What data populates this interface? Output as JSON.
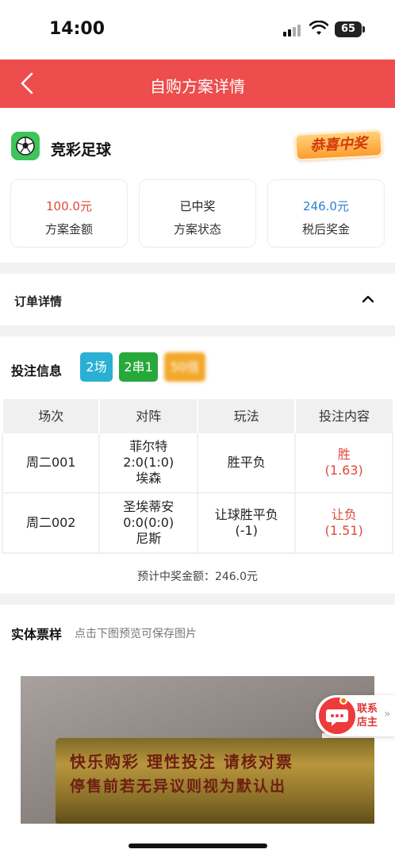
{
  "status_bar": {
    "time": "14:00",
    "battery": "65"
  },
  "nav": {
    "title": "自购方案详情"
  },
  "lottery": {
    "name": "竞彩足球",
    "badge": "恭喜中奖"
  },
  "stats": [
    {
      "value": "100.0元",
      "label": "方案金额",
      "color": "#e0493b"
    },
    {
      "value": "已中奖",
      "label": "方案状态",
      "color": "#222222"
    },
    {
      "value": "246.0元",
      "label": "税后奖金",
      "color": "#2f7fd3"
    }
  ],
  "order": {
    "title": "订单详情"
  },
  "bet": {
    "title": "投注信息",
    "tags": [
      {
        "text": "2场",
        "color": "#2bb0d4"
      },
      {
        "text": "2串1",
        "color": "#27a83a"
      },
      {
        "text": "50倍",
        "color": "#f2a82b"
      }
    ],
    "columns": [
      "场次",
      "对阵",
      "玩法",
      "投注内容"
    ],
    "rows": [
      {
        "match_no": "周二001",
        "home": "菲尔特",
        "score": "2:0(1:0)",
        "away": "埃森",
        "play": "胜平负",
        "play2": "",
        "pick": "胜",
        "odds": "(1.63)"
      },
      {
        "match_no": "周二002",
        "home": "圣埃蒂安",
        "score": "0:0(0:0)",
        "away": "尼斯",
        "play": "让球胜平负",
        "play2": "(-1)",
        "pick": "让负",
        "odds": "(1.51)"
      }
    ],
    "estimate": "预计中奖金额：246.0元"
  },
  "ticket": {
    "title": "实体票样",
    "hint": "点击下图预览可保存图片",
    "photo_line1": "快乐购彩  理性投注  请核对票",
    "photo_line2": "停售前若无异议则视为默认出"
  },
  "contact": {
    "label": "联系店主"
  }
}
